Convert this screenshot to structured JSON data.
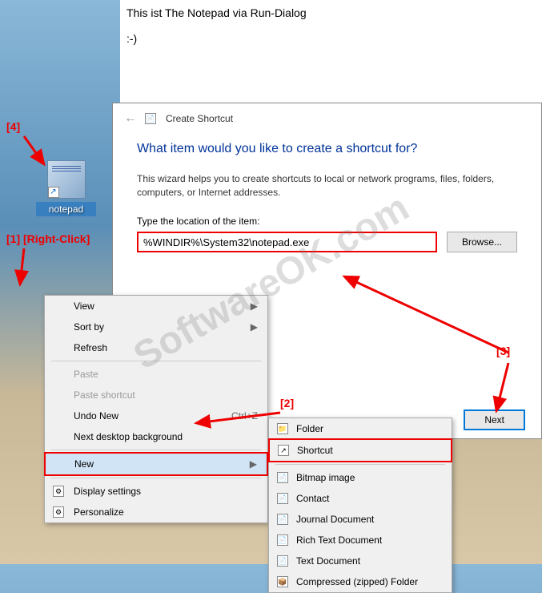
{
  "notepad": {
    "line1": "This ist The Notepad via Run-Dialog",
    "line2": ":-)"
  },
  "desktop_icon": {
    "label": "notepad"
  },
  "dialog": {
    "title": "Create Shortcut",
    "question": "What item would you like to create a shortcut for?",
    "description": "This wizard helps you to create shortcuts to local or network programs, files, folders, computers, or Internet addresses.",
    "field_label": "Type the location of the item:",
    "location_value": "%WINDIR%\\System32\\notepad.exe",
    "browse": "Browse...",
    "next": "Next"
  },
  "context_menu": {
    "items": [
      {
        "label": "View",
        "arrow": true
      },
      {
        "label": "Sort by",
        "arrow": true
      },
      {
        "label": "Refresh"
      },
      {
        "sep": true
      },
      {
        "label": "Paste",
        "disabled": true
      },
      {
        "label": "Paste shortcut",
        "disabled": true
      },
      {
        "label": "Undo New",
        "shortcut": "Ctrl+Z"
      },
      {
        "label": "Next desktop background"
      },
      {
        "sep": true
      },
      {
        "label": "New",
        "arrow": true,
        "highlighted": true
      },
      {
        "sep": true
      },
      {
        "label": "Display settings",
        "icon": true
      },
      {
        "label": "Personalize",
        "icon": true
      }
    ]
  },
  "submenu": {
    "items": [
      {
        "label": "Folder",
        "icon": "folder"
      },
      {
        "label": "Shortcut",
        "icon": "shortcut",
        "highlighted": true
      },
      {
        "sep": true
      },
      {
        "label": "Bitmap image",
        "icon": "file"
      },
      {
        "label": "Contact",
        "icon": "file"
      },
      {
        "label": "Journal Document",
        "icon": "file"
      },
      {
        "label": "Rich Text Document",
        "icon": "file"
      },
      {
        "label": "Text Document",
        "icon": "file"
      },
      {
        "label": "Compressed (zipped) Folder",
        "icon": "zip"
      }
    ]
  },
  "annotations": {
    "a1": "[1]",
    "a1_text": "[Right-Click]",
    "a2": "[2]",
    "a3": "[3]",
    "a4": "[4]"
  },
  "watermark": "SoftwareOK.com"
}
